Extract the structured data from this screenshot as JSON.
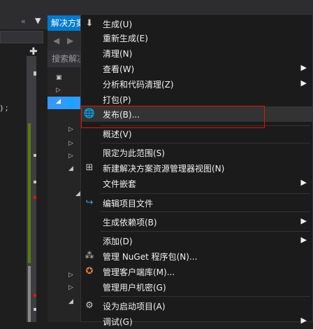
{
  "solution_explorer": {
    "header_title": "解决方案资源管理器",
    "search_placeholder": "搜索解决方案资源管理器"
  },
  "left_panel": {
    "code_fragment": ") ;"
  },
  "context_menu": {
    "items": [
      {
        "label": "生成(U)",
        "icon": "build-icon"
      },
      {
        "label": "重新生成(E)"
      },
      {
        "label": "清理(N)"
      },
      {
        "label": "查看(W)",
        "submenu": true
      },
      {
        "label": "分析和代码清理(Z)",
        "submenu": true
      },
      {
        "label": "打包(P)"
      },
      {
        "label": "发布(B)...",
        "icon": "globe-publish-icon",
        "highlighted": true
      },
      {
        "label": "概述(V)"
      },
      {
        "label": "限定为此范围(S)"
      },
      {
        "label": "新建解决方案资源管理器视图(N)",
        "icon": "new-view-icon"
      },
      {
        "label": "文件嵌套",
        "submenu": true
      },
      {
        "label": "编辑项目文件",
        "icon": "refresh-arrow-icon"
      },
      {
        "label": "生成依赖项(B)",
        "submenu": true
      },
      {
        "label": "添加(D)",
        "submenu": true
      },
      {
        "label": "管理 NuGet 程序包(N)...",
        "icon": "nuget-icon"
      },
      {
        "label": "管理客户端库(M)...",
        "icon": "library-icon"
      },
      {
        "label": "管理用户机密(G)"
      },
      {
        "label": "设为启动项目(A)",
        "icon": "gear-icon"
      },
      {
        "label": "调试(G)",
        "submenu": true
      }
    ]
  }
}
